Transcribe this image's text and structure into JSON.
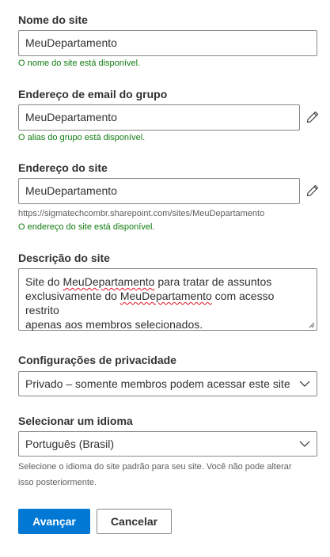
{
  "site_name": {
    "label": "Nome do site",
    "value": "MeuDepartamento",
    "status": "O nome do site está disponível."
  },
  "group_email": {
    "label": "Endereço de email do grupo",
    "value": "MeuDepartamento",
    "status": "O alias do grupo está disponível.",
    "edit_icon": "pencil-icon"
  },
  "site_address": {
    "label": "Endereço do site",
    "value": "MeuDepartamento",
    "url": "https://sigmatechcombr.sharepoint.com/sites/MeuDepartamento",
    "status": "O endereço do site está disponível.",
    "edit_icon": "pencil-icon"
  },
  "description": {
    "label": "Descrição do site",
    "line1_pre": "Site do ",
    "line1_word": "MeuDepartamento",
    "line1_post": " para tratar de assuntos",
    "line2_pre": "exclusivamente do ",
    "line2_word": "MeuDepartamento",
    "line2_post": " com acesso restrito",
    "line3": "apenas aos membros selecionados."
  },
  "privacy": {
    "label": "Configurações de privacidade",
    "selected": "Privado – somente membros podem acessar este site"
  },
  "language": {
    "label": "Selecionar um idioma",
    "selected": "Português (Brasil)",
    "hint_line1": "Selecione o idioma do site padrão para seu site. Você não pode alterar",
    "hint_line2": "isso posteriormente."
  },
  "buttons": {
    "next": "Avançar",
    "cancel": "Cancelar"
  },
  "colors": {
    "primary": "#0078d4",
    "success": "#107c10",
    "border": "#8a8886",
    "spellcheck": "#e81123"
  }
}
